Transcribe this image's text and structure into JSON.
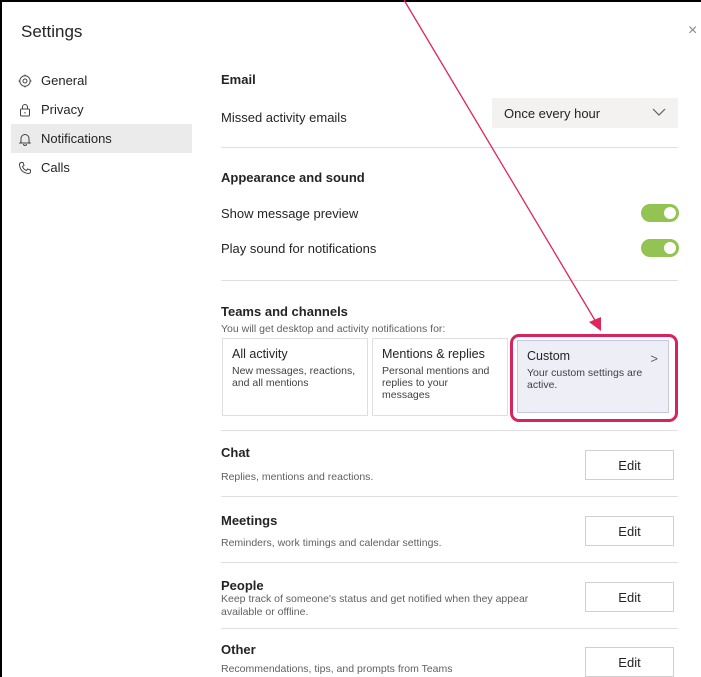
{
  "window": {
    "title": "Settings",
    "close_glyph": "×"
  },
  "sidebar": {
    "items": [
      {
        "label": "General",
        "icon": "gear-icon"
      },
      {
        "label": "Privacy",
        "icon": "lock-icon"
      },
      {
        "label": "Notifications",
        "icon": "bell-icon",
        "active": true
      },
      {
        "label": "Calls",
        "icon": "phone-icon"
      }
    ]
  },
  "email": {
    "title": "Email",
    "missed_label": "Missed activity emails",
    "frequency_value": "Once every hour"
  },
  "appearance": {
    "title": "Appearance and sound",
    "preview_label": "Show message preview",
    "preview_on": true,
    "sound_label": "Play sound for notifications",
    "sound_on": true
  },
  "teams": {
    "title": "Teams and channels",
    "subtitle": "You will get desktop and activity notifications for:",
    "cards": [
      {
        "title": "All activity",
        "desc_line1": "New messages, reactions,",
        "desc_line2": "and all mentions"
      },
      {
        "title": "Mentions & replies",
        "desc_line1": "Personal mentions and",
        "desc_line2": "replies to your messages"
      },
      {
        "title": "Custom",
        "desc_line1": "Your custom settings are",
        "desc_line2": "active.",
        "selected": true,
        "chevron": ">"
      }
    ]
  },
  "chat": {
    "title": "Chat",
    "desc": "Replies, mentions and reactions.",
    "button": "Edit"
  },
  "meetings": {
    "title": "Meetings",
    "desc": "Reminders, work timings and calendar settings.",
    "button": "Edit"
  },
  "people": {
    "title": "People",
    "desc_line1": "Keep track of someone's status and get notified when they appear",
    "desc_line2": "available or offline.",
    "button": "Edit"
  },
  "other": {
    "title": "Other",
    "desc": "Recommendations, tips, and prompts from Teams",
    "button": "Edit"
  },
  "annotation": {
    "arrow_color": "#e0245e",
    "highlight_color": "#d6245f"
  },
  "colors": {
    "toggle_on": "#92c353",
    "selected_card": "#eeeef7"
  }
}
